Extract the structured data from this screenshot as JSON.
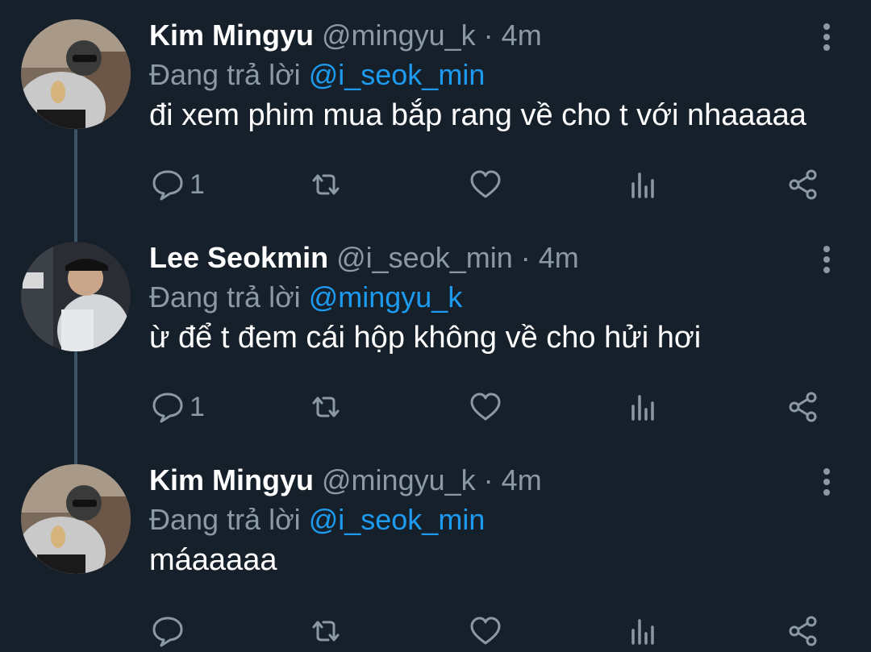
{
  "tweets": [
    {
      "name": "Kim Mingyu",
      "handle": "@mingyu_k",
      "separator": "·",
      "time": "4m",
      "reply_prefix": "Đang trả lời",
      "reply_to": "@i_seok_min",
      "text": "đi xem phim mua bắp rang về cho t với nhaaaaa",
      "reply_count": "1",
      "avatar": "avatar-kim-mingyu"
    },
    {
      "name": "Lee Seokmin",
      "handle": "@i_seok_min",
      "separator": "·",
      "time": "4m",
      "reply_prefix": "Đang trả lời",
      "reply_to": "@mingyu_k",
      "text": "ừ để t đem cái hộp không về cho hửi hơi",
      "reply_count": "1",
      "avatar": "avatar-lee-seokmin"
    },
    {
      "name": "Kim Mingyu",
      "handle": "@mingyu_k",
      "separator": "·",
      "time": "4m",
      "reply_prefix": "Đang trả lời",
      "reply_to": "@i_seok_min",
      "text": "máaaaaa",
      "reply_count": "",
      "avatar": "avatar-kim-mingyu"
    }
  ],
  "icons": {
    "reply": "speech-bubble-icon",
    "retweet": "retweet-icon",
    "like": "heart-icon",
    "analytics": "bar-chart-icon",
    "share": "share-icon",
    "more": "vertical-dots-icon"
  },
  "colors": {
    "background": "#15202b",
    "muted": "#8b98a5",
    "link": "#1d9bf0",
    "thread_line": "#3d5466"
  }
}
